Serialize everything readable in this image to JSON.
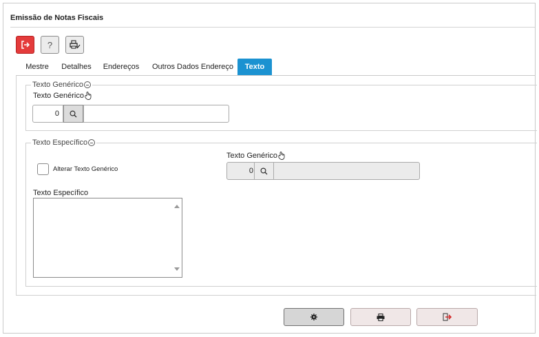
{
  "window": {
    "title": "Emissão de Notas Fiscais"
  },
  "toolbar": {
    "exit_icon": "exit-icon",
    "help_label": "?",
    "print_icon": "printer-edit-icon",
    "exit_color": "#e43b3b"
  },
  "tabs": [
    {
      "label": "Mestre",
      "active": false
    },
    {
      "label": "Detalhes",
      "active": false
    },
    {
      "label": "Endereços",
      "active": false
    },
    {
      "label": "Outros Dados Endereço",
      "active": false
    },
    {
      "label": "Texto",
      "active": true
    }
  ],
  "accent_color": "#1b92d1",
  "section_generic": {
    "legend": "Texto Genérico",
    "field_label": "Texto Genérico",
    "code_value": "0",
    "description_value": ""
  },
  "section_specific": {
    "legend": "Texto Específico",
    "checkbox_label": "Alterar Texto Genérico",
    "checkbox_checked": false,
    "generic_label": "Texto Genérico",
    "generic_code_value": "0",
    "generic_description_value": "",
    "specific_label": "Texto Específico",
    "specific_value": ""
  },
  "bottom_buttons": {
    "config_icon": "gear-icon",
    "print_icon": "printer-icon",
    "exit_icon": "exit-arrow-icon"
  }
}
